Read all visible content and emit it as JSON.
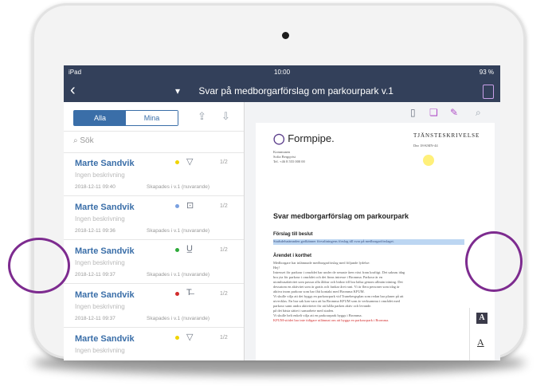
{
  "status": {
    "left": "iPad",
    "time": "10:00",
    "battery": "93 %"
  },
  "nav": {
    "title": "Svar på medborgarförslag om parkourpark",
    "version": "v.1"
  },
  "tabs": [
    {
      "label": "Alla",
      "active": true
    },
    {
      "label": "Mina",
      "active": false
    }
  ],
  "search": {
    "placeholder": "Sök"
  },
  "items": [
    {
      "name": "Marte Sandvik",
      "desc": "Ingen beskrivning",
      "date": "2018-12-11 09:40",
      "meta": "Skapades i v.1 (nuvarande)",
      "count": "1/2",
      "dot": "#f0d400",
      "icon": "triangle-down-icon"
    },
    {
      "name": "Marte Sandvik",
      "desc": "Ingen beskrivning",
      "date": "2018-12-11 09:36",
      "meta": "Skapades i v.1 (nuvarande)",
      "count": "1/2",
      "dot": "#7aa0e0",
      "icon": "text-box-icon"
    },
    {
      "name": "Marte Sandvik",
      "desc": "Ingen beskrivning",
      "date": "2018-12-11 09:37",
      "meta": "Skapades i v.1 (nuvarande)",
      "count": "1/2",
      "dot": "#2eaa3a",
      "icon": "underline-icon"
    },
    {
      "name": "Marte Sandvik",
      "desc": "Ingen beskrivning",
      "date": "2018-12-11 09:37",
      "meta": "Skapades i v.1 (nuvarande)",
      "count": "1/2",
      "dot": "#d22c2c",
      "icon": "strikethrough-icon"
    },
    {
      "name": "Marte Sandvik",
      "desc": "Ingen beskrivning",
      "date": "",
      "meta": "",
      "count": "1/2",
      "dot": "#f0d400",
      "icon": "triangle-down-icon"
    }
  ],
  "document": {
    "logo": "Formpipe.",
    "doctype": "TJÄNSTESKRIVELSE",
    "meta_lines": [
      "Kommunen",
      "Sofia Bergqvist",
      "Tel. +46 8 555 000 00"
    ],
    "date_line": "Dnr 18-KMN-44",
    "heading": "Svar medborgarförslag om parkourpark",
    "section1_title": "Förslag till beslut",
    "highlight_text": "Stadsdelsnämnden godkänner förvaltningens förslag till svar på medborgarförslaget.",
    "section2_title": "Ärendet i korthet",
    "body_lines": [
      "Medborgare har inlämnade medborgarförslag med följande lydelse:",
      "Hej!",
      "Intresset för parkour i området har under de senaste åren växt fram kraftigt. Det saknas idag",
      "bra yta för parkour i området och det finns intresse i Bromma. Parkour är en",
      "utomhusaktivitet som passar alla åldrar och bidrar till bra hälsa genom allmän träning. Det",
      "dessutom en aktivitet som är gratis och funkar året runt. Vi är flera personer som idag är",
      "aktiva inom parkour som har fått kontakt med Bromma KFUM.",
      "Vi skulle vilja att det byggs en parkourpark vid Tranebergsplan som redan har planer på att",
      "utvecklas. En bra sak kan vara att ha Bromma KFUM som är verksamma i området med",
      "parkour samt andra aktiviteter för att hålla parken aktiv och levande.",
      "på det bästa sättet i samarbete med staden.",
      "Vi skulle helt enkelt vilja att en parkourpark byggs i Bromma.",
      "KFUM-stödet har inte tidigare utlämnat om att bygga en parkourpark i Bromma."
    ]
  },
  "colors": {
    "nav": "#33405a",
    "accent": "#3a6ea8",
    "annotation_circle": "#7d2b8f"
  }
}
